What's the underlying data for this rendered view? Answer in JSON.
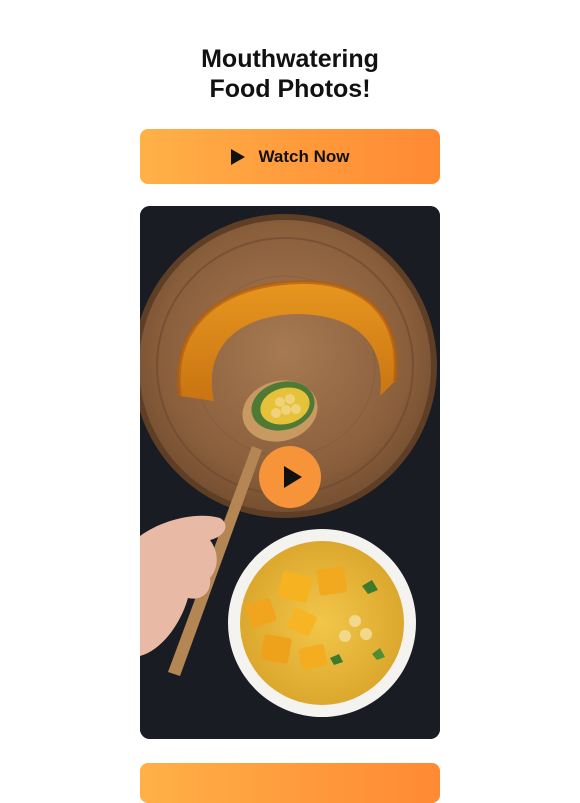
{
  "header": {
    "title_line1": "Mouthwatering",
    "title_line2": "Food Photos!"
  },
  "cta": {
    "label": "Watch Now",
    "icon": "play-icon"
  },
  "photo": {
    "description_icon": "food-photo",
    "overlay_icon": "play-icon"
  },
  "colors": {
    "accent": "#ff9a3c",
    "button_text": "#111111",
    "photo_background": "#1a1c24"
  }
}
